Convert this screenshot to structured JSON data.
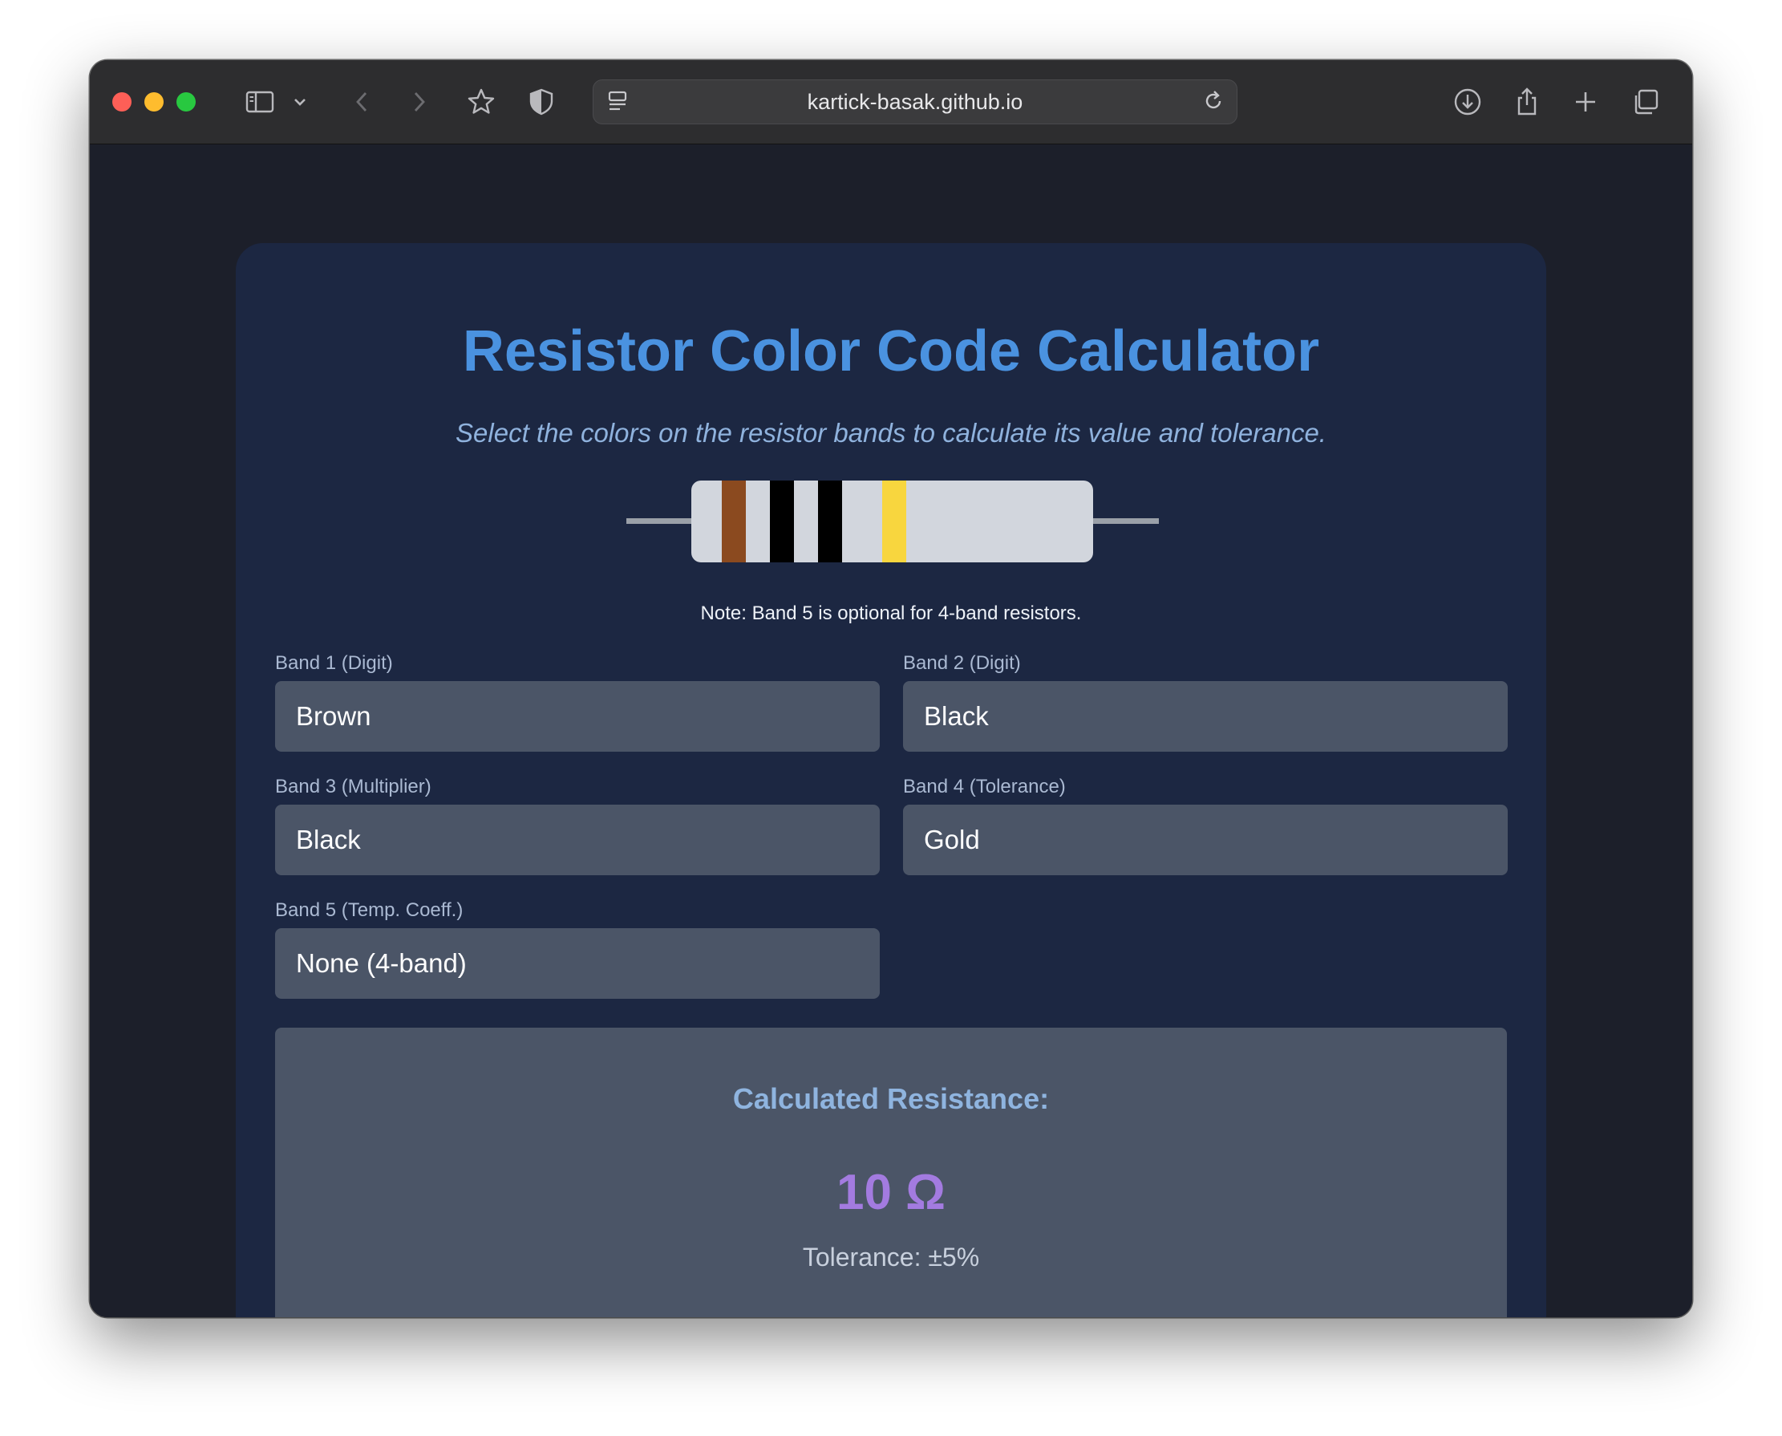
{
  "browser": {
    "url": "kartick-basak.github.io"
  },
  "page": {
    "title": "Resistor Color Code Calculator",
    "subtitle": "Select the colors on the resistor bands to calculate its value and tolerance.",
    "note": "Note: Band 5 is optional for 4-band resistors."
  },
  "resistor": {
    "body_color": "#d2d6dd",
    "bands": [
      {
        "color_name": "Brown",
        "hex": "#8b4a1f"
      },
      {
        "color_name": "Black",
        "hex": "#000000"
      },
      {
        "color_name": "Black",
        "hex": "#000000"
      },
      {
        "color_name": "Gold",
        "hex": "#f8d63e"
      }
    ]
  },
  "bands": {
    "band1": {
      "label": "Band 1 (Digit)",
      "value": "Brown"
    },
    "band2": {
      "label": "Band 2 (Digit)",
      "value": "Black"
    },
    "band3": {
      "label": "Band 3 (Multiplier)",
      "value": "Black"
    },
    "band4": {
      "label": "Band 4 (Tolerance)",
      "value": "Gold"
    },
    "band5": {
      "label": "Band 5 (Temp. Coeff.)",
      "value": "None (4-band)"
    }
  },
  "result": {
    "label": "Calculated Resistance:",
    "value": "10 Ω",
    "tolerance": "Tolerance: ±5%"
  },
  "colors": {
    "title": "#4a92e0",
    "result_value": "#a37be0",
    "card": "#1c2742"
  }
}
